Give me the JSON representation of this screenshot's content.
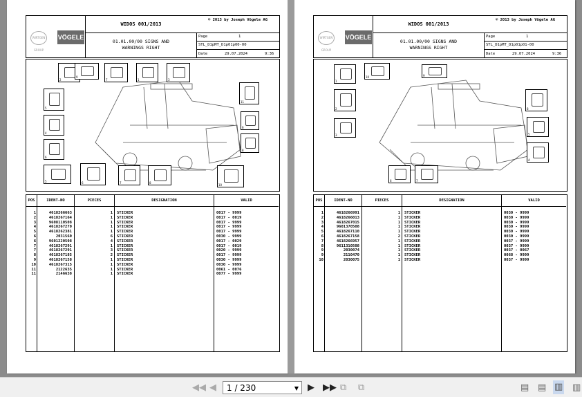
{
  "pages": [
    {
      "header": {
        "logo_left": "WIRTGEN GROUP",
        "logo_right": "VÖGELE",
        "title": "WIDOS 001/2013",
        "copyright": "© 2013 by Joseph Vögele AG",
        "subtitle_1": "01.01.00/00 SIGNS AND",
        "subtitle_2": "WARNINGS RIGHT",
        "page_label": "Page",
        "page_no": "1",
        "doc_id": "STL_D1pMT_D1p01p00-00",
        "date_label": "Date",
        "date": "29.07.2024",
        "time": "9:36"
      },
      "callouts": [
        "2",
        "9",
        "7",
        "1",
        "3",
        "5",
        "4",
        "6",
        "5",
        "6",
        "7",
        "8",
        "10",
        "11",
        "6",
        "8"
      ],
      "table": {
        "headers": [
          "POS",
          "IDENT-NO",
          "PIECES",
          "DESIGNATION",
          "VALID"
        ],
        "rows": [
          [
            "1",
            "4618266663",
            "1",
            "STICKER",
            "0017 - 9999"
          ],
          [
            "2",
            "4618267164",
            "1",
            "STICKER",
            "0017 - 0019"
          ],
          [
            "3",
            "9608110508",
            "1",
            "STICKER",
            "0017 - 9999"
          ],
          [
            "4",
            "4618267270",
            "1",
            "STICKER",
            "0017 - 9999"
          ],
          [
            "5",
            "4618262381",
            "1",
            "STICKER",
            "0017 - 9999"
          ],
          [
            "6",
            "2031560",
            "6",
            "STICKER",
            "0030 - 9999"
          ],
          [
            "6",
            "9601220508",
            "4",
            "STICKER",
            "0017 - 0029"
          ],
          [
            "7",
            "4618267291",
            "1",
            "STICKER",
            "0017 - 0019"
          ],
          [
            "7",
            "4618267291",
            "3",
            "STICKER",
            "0020 - 9999"
          ],
          [
            "8",
            "4618267185",
            "2",
            "STICKER",
            "0017 - 9999"
          ],
          [
            "9",
            "4618267158",
            "1",
            "STICKER",
            "0030 - 9999"
          ],
          [
            "10",
            "4618267315",
            "1",
            "STICKER",
            "0030 - 9999"
          ],
          [
            "11",
            "2122635",
            "1",
            "STICKER",
            "0061 - 0076"
          ],
          [
            "11",
            "2146638",
            "1",
            "STICKER",
            "0077 - 9999"
          ]
        ]
      }
    },
    {
      "header": {
        "logo_left": "WIRTGEN GROUP",
        "logo_right": "VÖGELE",
        "title": "WIDOS 001/2013",
        "copyright": "© 2013 by Joseph Vögele AG",
        "subtitle_1": "01.01.00/00 SIGNS AND",
        "subtitle_2": "WARNINGS RIGHT",
        "page_label": "Page",
        "page_no": "1",
        "doc_id": "STL_D1pMT_D1p01p01-00",
        "date_label": "Date",
        "date": "29.07.2024",
        "time": "9:36"
      },
      "callouts": [
        "1",
        "10",
        "9",
        "2",
        "3",
        "8",
        "5",
        "4",
        "6",
        "7"
      ],
      "table": {
        "headers": [
          "POS",
          "IDENT-NO",
          "PIECES",
          "DESIGNATION",
          "VALID"
        ],
        "rows": [
          [
            "1",
            "4618266991",
            "1",
            "STICKER",
            "0030 - 9999"
          ],
          [
            "2",
            "4618266013",
            "1",
            "STICKER",
            "0030 - 9999"
          ],
          [
            "3",
            "4618267015",
            "1",
            "STICKER",
            "0030 - 9999"
          ],
          [
            "4",
            "9601370508",
            "1",
            "STICKER",
            "0030 - 9999"
          ],
          [
            "5",
            "4618267110",
            "1",
            "STICKER",
            "0030 - 9999"
          ],
          [
            "6",
            "4618267158",
            "2",
            "STICKER",
            "0030 - 9999"
          ],
          [
            "7",
            "4618266957",
            "1",
            "STICKER",
            "0037 - 9999"
          ],
          [
            "8",
            "9611310508",
            "1",
            "STICKER",
            "0037 - 9999"
          ],
          [
            "9",
            "2030074",
            "1",
            "STICKER",
            "0037 - 0067"
          ],
          [
            "9",
            "2110470",
            "1",
            "STICKER",
            "0068 - 9999"
          ],
          [
            "10",
            "2030075",
            "1",
            "STICKER",
            "0037 - 9999"
          ]
        ]
      }
    }
  ],
  "toolbar": {
    "page_selector": "1 / 230",
    "first_icon": "first-page-icon",
    "prev_icon": "prev-page-icon",
    "next_icon": "next-page-icon",
    "last_icon": "last-page-icon"
  }
}
